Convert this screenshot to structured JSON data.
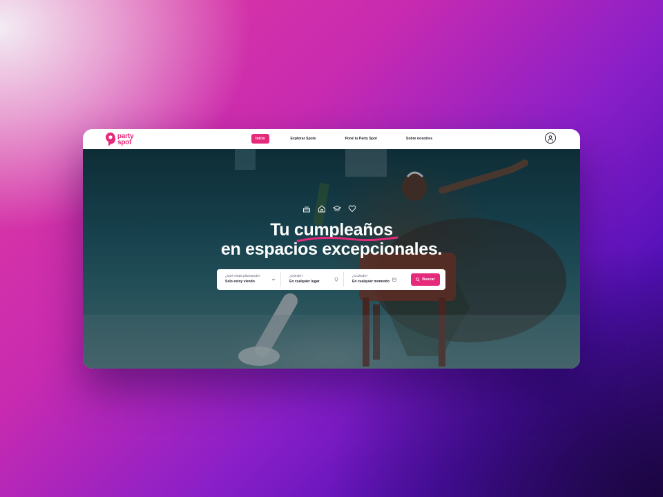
{
  "brand": {
    "name_line1": "party",
    "name_line2": "spot",
    "color": "#e52a7c"
  },
  "nav": {
    "items": [
      {
        "label": "Inicio",
        "active": true
      },
      {
        "label": "Explorar Spots",
        "active": false
      },
      {
        "label": "Poné tu Party Spot",
        "active": false
      },
      {
        "label": "Sobre nosotros",
        "active": false
      }
    ]
  },
  "hero": {
    "category_icons": [
      "cake-icon",
      "home-icon",
      "graduation-cap-icon",
      "heart-icon"
    ],
    "headline_line1": "Tu cumpleaños",
    "headline_line2": "en espacios excepcionales."
  },
  "search": {
    "what_label": "¿Qué estás planeando?",
    "what_value": "Solo estoy viendo",
    "where_label": "¿Dónde?",
    "where_value": "En cualquier lugar",
    "when_label": "¿Cuándo?",
    "when_value": "En cualquier momento",
    "button_label": "Buscar"
  }
}
